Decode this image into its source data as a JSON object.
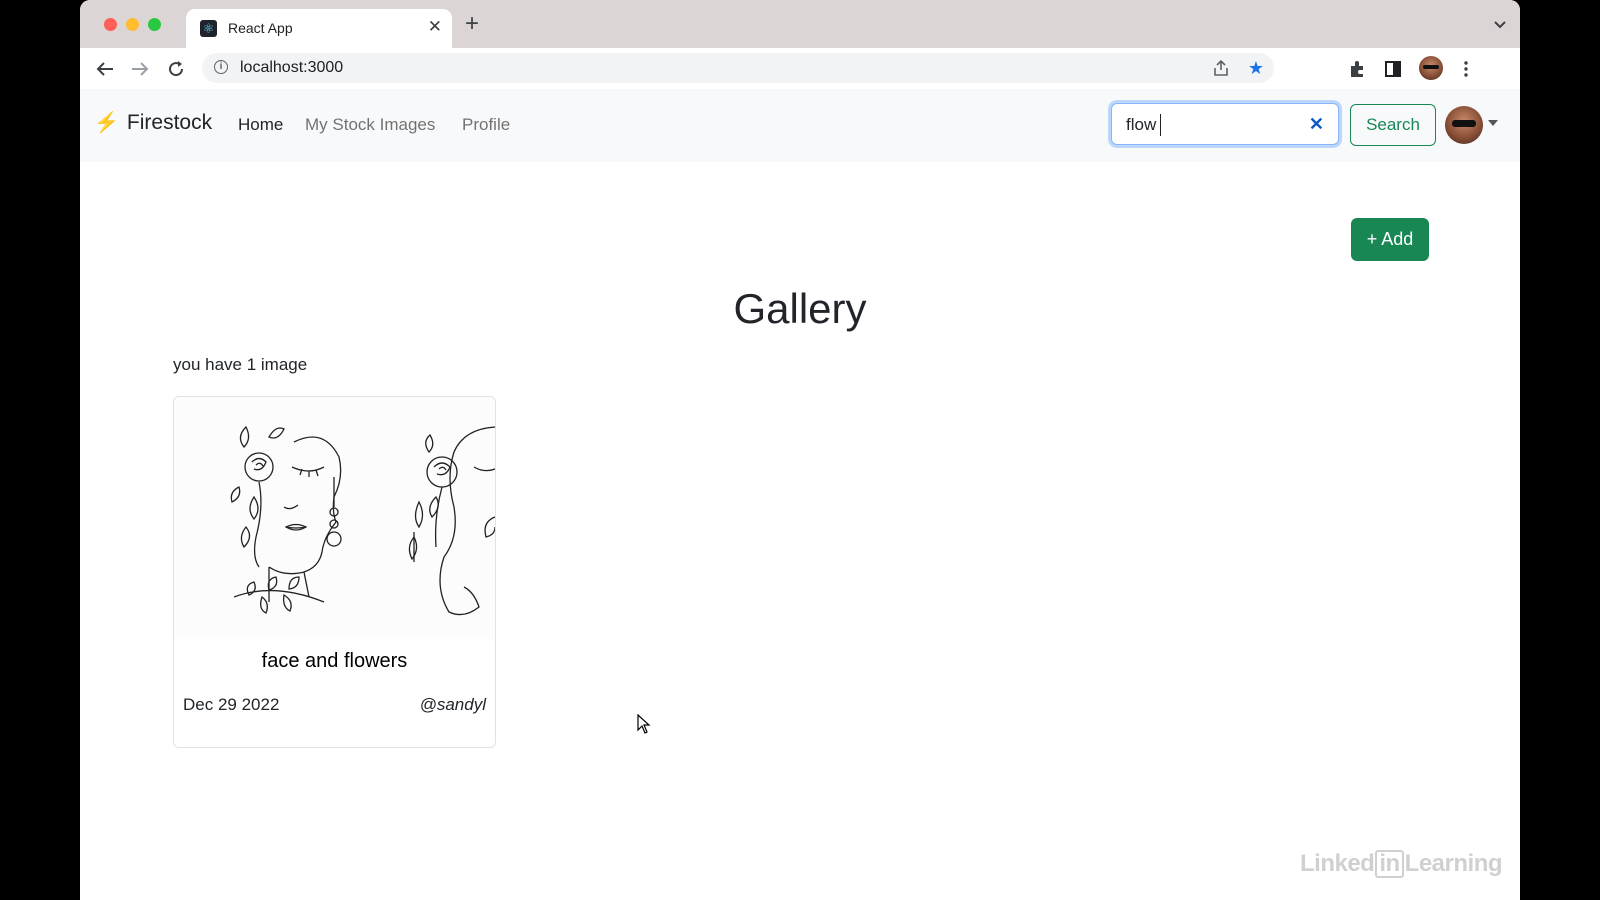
{
  "browser": {
    "tab": {
      "title": "React App",
      "favicon": "react-icon",
      "close": "✕"
    },
    "new_tab": "+",
    "url": "localhost:3000",
    "icons": [
      "back-arrow-icon",
      "forward-arrow-icon",
      "reload-icon",
      "info-icon",
      "share-icon",
      "star-icon",
      "extensions-icon",
      "side-panel-icon",
      "profile-avatar",
      "kebab-menu-icon"
    ],
    "accent_color": "#1a73e8"
  },
  "navbar": {
    "brand": {
      "icon": "⚡",
      "name": "Firestock"
    },
    "links": [
      {
        "label": "Home",
        "active": true
      },
      {
        "label": "My Stock Images",
        "active": false
      },
      {
        "label": "Profile",
        "active": false
      }
    ],
    "search": {
      "value": "flow",
      "clear_icon": "✕"
    },
    "search_button": "Search",
    "success_color": "#198754"
  },
  "main": {
    "add_button": "+ Add",
    "title": "Gallery",
    "count_text": "you have 1 image",
    "cards": [
      {
        "title": "face and flowers",
        "date": "Dec 29 2022",
        "user": "@sandyl"
      }
    ]
  },
  "watermark": {
    "pre": "Linked",
    "in": "in",
    "post": "Learning"
  }
}
